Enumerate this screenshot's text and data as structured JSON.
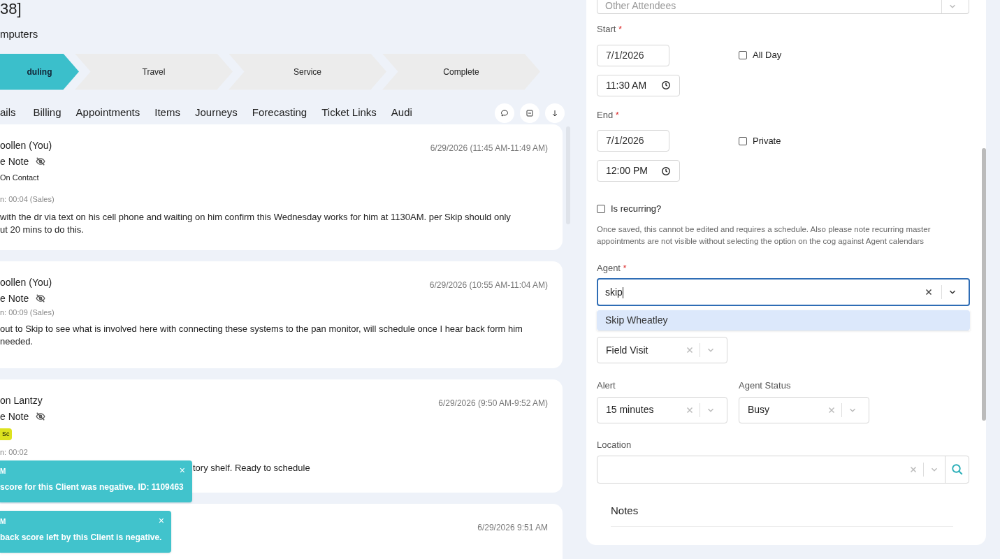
{
  "header": {
    "title": "38]",
    "subtitle": "mputers"
  },
  "stages": [
    {
      "label": "duling",
      "selected": true
    },
    {
      "label": "Travel",
      "selected": false
    },
    {
      "label": "Service",
      "selected": false
    },
    {
      "label": "Complete",
      "selected": false
    }
  ],
  "tabs": [
    "ails",
    "Billing",
    "Appointments",
    "Items",
    "Journeys",
    "Forecasting",
    "Ticket Links",
    "Audi"
  ],
  "notes": [
    {
      "author": "oollen (You)",
      "type": "e Note",
      "hidden": true,
      "contact": "On Contact",
      "duration": "n: 00:04 (Sales)",
      "time": "6/29/2026 (11:45 AM-11:49 AM)",
      "body": " with the dr via text on his cell phone and waiting on him confirm this Wednesday works for him at 1130AM.  per Skip should only\nut 20 mins to do this."
    },
    {
      "author": "oollen (You)",
      "type": "e Note",
      "hidden": true,
      "duration": "n: 00:09 (Sales)",
      "time": "6/29/2026 (10:55 AM-11:04 AM)",
      "body": "out to Skip to see what is involved here with connecting these systems to the pan monitor, will schedule once I hear back form him\nneeded."
    },
    {
      "author": "on Lantzy",
      "type": "e Note",
      "hidden": true,
      "tag": "Sc",
      "duration": "n: 00:02",
      "time": "6/29/2026 (9:50 AM-9:52 AM)",
      "body": "tory shelf. Ready to schedule"
    },
    {
      "time": "6/29/2026 9:51 AM"
    }
  ],
  "toasts": [
    {
      "title": "M",
      "message": "score for this Client was negative. ID: 1109463",
      "close": "×"
    },
    {
      "title": "M",
      "message": "back score left by this Client is negative.",
      "close": "×"
    }
  ],
  "form": {
    "attendees": {
      "placeholder": "Other Attendees"
    },
    "start": {
      "label": "Start",
      "required": "*",
      "date": "7/1/2026",
      "time": "11:30 AM",
      "checkbox": {
        "label": "All Day",
        "checked": false
      }
    },
    "end": {
      "label": "End",
      "required": "*",
      "date": "7/1/2026",
      "time": "12:00 PM",
      "checkbox": {
        "label": "Private",
        "checked": false
      }
    },
    "recurring": {
      "label": "Is recurring?",
      "checked": false,
      "hint": "Once saved, this cannot be edited and requires a schedule. Also please note recurring master appointments are not visible without selecting the option on the cog against Agent calendars"
    },
    "agent": {
      "label": "Agent",
      "required": "*",
      "value": "skip",
      "options": [
        {
          "label": "Skip Wheatley",
          "selected": true
        }
      ]
    },
    "type": {
      "value": "Field Visit"
    },
    "alert": {
      "label": "Alert",
      "value": "15 minutes"
    },
    "agent_status": {
      "label": "Agent Status",
      "value": "Busy"
    },
    "location": {
      "label": "Location"
    },
    "notes_heading": "Notes"
  }
}
